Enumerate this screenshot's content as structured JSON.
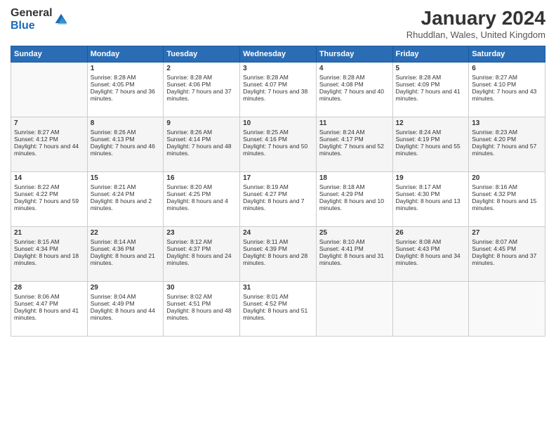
{
  "logo": {
    "general": "General",
    "blue": "Blue"
  },
  "title": "January 2024",
  "location": "Rhuddlan, Wales, United Kingdom",
  "headers": [
    "Sunday",
    "Monday",
    "Tuesday",
    "Wednesday",
    "Thursday",
    "Friday",
    "Saturday"
  ],
  "weeks": [
    [
      {
        "day": "",
        "sunrise": "",
        "sunset": "",
        "daylight": ""
      },
      {
        "day": "1",
        "sunrise": "Sunrise: 8:28 AM",
        "sunset": "Sunset: 4:05 PM",
        "daylight": "Daylight: 7 hours and 36 minutes."
      },
      {
        "day": "2",
        "sunrise": "Sunrise: 8:28 AM",
        "sunset": "Sunset: 4:06 PM",
        "daylight": "Daylight: 7 hours and 37 minutes."
      },
      {
        "day": "3",
        "sunrise": "Sunrise: 8:28 AM",
        "sunset": "Sunset: 4:07 PM",
        "daylight": "Daylight: 7 hours and 38 minutes."
      },
      {
        "day": "4",
        "sunrise": "Sunrise: 8:28 AM",
        "sunset": "Sunset: 4:08 PM",
        "daylight": "Daylight: 7 hours and 40 minutes."
      },
      {
        "day": "5",
        "sunrise": "Sunrise: 8:28 AM",
        "sunset": "Sunset: 4:09 PM",
        "daylight": "Daylight: 7 hours and 41 minutes."
      },
      {
        "day": "6",
        "sunrise": "Sunrise: 8:27 AM",
        "sunset": "Sunset: 4:10 PM",
        "daylight": "Daylight: 7 hours and 43 minutes."
      }
    ],
    [
      {
        "day": "7",
        "sunrise": "Sunrise: 8:27 AM",
        "sunset": "Sunset: 4:12 PM",
        "daylight": "Daylight: 7 hours and 44 minutes."
      },
      {
        "day": "8",
        "sunrise": "Sunrise: 8:26 AM",
        "sunset": "Sunset: 4:13 PM",
        "daylight": "Daylight: 7 hours and 46 minutes."
      },
      {
        "day": "9",
        "sunrise": "Sunrise: 8:26 AM",
        "sunset": "Sunset: 4:14 PM",
        "daylight": "Daylight: 7 hours and 48 minutes."
      },
      {
        "day": "10",
        "sunrise": "Sunrise: 8:25 AM",
        "sunset": "Sunset: 4:16 PM",
        "daylight": "Daylight: 7 hours and 50 minutes."
      },
      {
        "day": "11",
        "sunrise": "Sunrise: 8:24 AM",
        "sunset": "Sunset: 4:17 PM",
        "daylight": "Daylight: 7 hours and 52 minutes."
      },
      {
        "day": "12",
        "sunrise": "Sunrise: 8:24 AM",
        "sunset": "Sunset: 4:19 PM",
        "daylight": "Daylight: 7 hours and 55 minutes."
      },
      {
        "day": "13",
        "sunrise": "Sunrise: 8:23 AM",
        "sunset": "Sunset: 4:20 PM",
        "daylight": "Daylight: 7 hours and 57 minutes."
      }
    ],
    [
      {
        "day": "14",
        "sunrise": "Sunrise: 8:22 AM",
        "sunset": "Sunset: 4:22 PM",
        "daylight": "Daylight: 7 hours and 59 minutes."
      },
      {
        "day": "15",
        "sunrise": "Sunrise: 8:21 AM",
        "sunset": "Sunset: 4:24 PM",
        "daylight": "Daylight: 8 hours and 2 minutes."
      },
      {
        "day": "16",
        "sunrise": "Sunrise: 8:20 AM",
        "sunset": "Sunset: 4:25 PM",
        "daylight": "Daylight: 8 hours and 4 minutes."
      },
      {
        "day": "17",
        "sunrise": "Sunrise: 8:19 AM",
        "sunset": "Sunset: 4:27 PM",
        "daylight": "Daylight: 8 hours and 7 minutes."
      },
      {
        "day": "18",
        "sunrise": "Sunrise: 8:18 AM",
        "sunset": "Sunset: 4:29 PM",
        "daylight": "Daylight: 8 hours and 10 minutes."
      },
      {
        "day": "19",
        "sunrise": "Sunrise: 8:17 AM",
        "sunset": "Sunset: 4:30 PM",
        "daylight": "Daylight: 8 hours and 13 minutes."
      },
      {
        "day": "20",
        "sunrise": "Sunrise: 8:16 AM",
        "sunset": "Sunset: 4:32 PM",
        "daylight": "Daylight: 8 hours and 15 minutes."
      }
    ],
    [
      {
        "day": "21",
        "sunrise": "Sunrise: 8:15 AM",
        "sunset": "Sunset: 4:34 PM",
        "daylight": "Daylight: 8 hours and 18 minutes."
      },
      {
        "day": "22",
        "sunrise": "Sunrise: 8:14 AM",
        "sunset": "Sunset: 4:36 PM",
        "daylight": "Daylight: 8 hours and 21 minutes."
      },
      {
        "day": "23",
        "sunrise": "Sunrise: 8:12 AM",
        "sunset": "Sunset: 4:37 PM",
        "daylight": "Daylight: 8 hours and 24 minutes."
      },
      {
        "day": "24",
        "sunrise": "Sunrise: 8:11 AM",
        "sunset": "Sunset: 4:39 PM",
        "daylight": "Daylight: 8 hours and 28 minutes."
      },
      {
        "day": "25",
        "sunrise": "Sunrise: 8:10 AM",
        "sunset": "Sunset: 4:41 PM",
        "daylight": "Daylight: 8 hours and 31 minutes."
      },
      {
        "day": "26",
        "sunrise": "Sunrise: 8:08 AM",
        "sunset": "Sunset: 4:43 PM",
        "daylight": "Daylight: 8 hours and 34 minutes."
      },
      {
        "day": "27",
        "sunrise": "Sunrise: 8:07 AM",
        "sunset": "Sunset: 4:45 PM",
        "daylight": "Daylight: 8 hours and 37 minutes."
      }
    ],
    [
      {
        "day": "28",
        "sunrise": "Sunrise: 8:06 AM",
        "sunset": "Sunset: 4:47 PM",
        "daylight": "Daylight: 8 hours and 41 minutes."
      },
      {
        "day": "29",
        "sunrise": "Sunrise: 8:04 AM",
        "sunset": "Sunset: 4:49 PM",
        "daylight": "Daylight: 8 hours and 44 minutes."
      },
      {
        "day": "30",
        "sunrise": "Sunrise: 8:02 AM",
        "sunset": "Sunset: 4:51 PM",
        "daylight": "Daylight: 8 hours and 48 minutes."
      },
      {
        "day": "31",
        "sunrise": "Sunrise: 8:01 AM",
        "sunset": "Sunset: 4:52 PM",
        "daylight": "Daylight: 8 hours and 51 minutes."
      },
      {
        "day": "",
        "sunrise": "",
        "sunset": "",
        "daylight": ""
      },
      {
        "day": "",
        "sunrise": "",
        "sunset": "",
        "daylight": ""
      },
      {
        "day": "",
        "sunrise": "",
        "sunset": "",
        "daylight": ""
      }
    ]
  ]
}
